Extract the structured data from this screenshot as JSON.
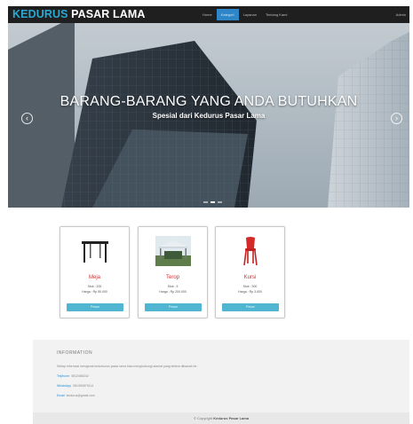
{
  "navbar": {
    "brand_first": "KEDURUS",
    "brand_second": " PASAR LAMA",
    "items": [
      {
        "label": "Home",
        "active": false
      },
      {
        "label": "Kategori",
        "active": true
      },
      {
        "label": "Layanan",
        "active": false
      },
      {
        "label": "Tentang Kami",
        "active": false
      }
    ],
    "right_label": "Admin",
    "colors": {
      "bar": "#1f1f1f",
      "brand_accent": "#2aa8d2",
      "active": "#2e86c8"
    }
  },
  "hero": {
    "title": "BARANG-BARANG YANG ANDA BUTUHKAN",
    "subtitle": "Spesial dari Kedurus Pasar Lama",
    "prev_icon": "chevron-left-icon",
    "next_icon": "chevron-right-icon",
    "prev_glyph": "‹",
    "next_glyph": "›",
    "slide_count": 3,
    "active_slide": 1
  },
  "products": [
    {
      "name": "Meja",
      "stock": "Stok : 200",
      "price": "Harga : Rp 50.000",
      "button": "Pesan",
      "icon": "table-icon"
    },
    {
      "name": "Terop",
      "stock": "Stok : 5",
      "price": "Harga : Rp 200.000",
      "button": "Pesan",
      "icon": "tent-icon"
    },
    {
      "name": "Kursi",
      "stock": "Stok : 300",
      "price": "Harga : Rp 3.000",
      "button": "Pesan",
      "icon": "chair-icon"
    }
  ],
  "footer": {
    "heading": "INFORMATION",
    "description": "Setiap informasi mengenai kedurkurus pasar lama bisa menghubungi alamat yang tertera dibawah ini :",
    "contacts": [
      {
        "label": "Telphone",
        "value": "0812456242"
      },
      {
        "label": "WhatsApp",
        "value": "081350879114"
      },
      {
        "label": "Email",
        "value": "kedurus@gmail.com"
      }
    ],
    "copyright_prefix": "© Copyright ",
    "copyright_brand": "Kedurus Pasar Lama"
  }
}
